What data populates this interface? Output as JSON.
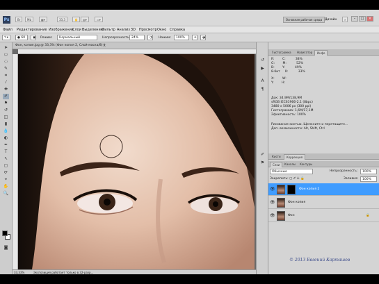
{
  "appbar": {
    "logo": "Ps",
    "zoom_display": "33,3",
    "workspace_label": "Основная рабочая среда",
    "workspace_active": "Дизайн",
    "min": "–",
    "max": "□",
    "close": "×"
  },
  "menu": [
    "Файл",
    "Редактирование",
    "Изображение",
    "Слои",
    "Выделение",
    "Фильтр",
    "Анализ",
    "3D",
    "Просмотр",
    "Окно",
    "Справка"
  ],
  "options": {
    "mode_label": "Режим:",
    "mode_value": "Нормальный",
    "opacity_label": "Непрозрачность:",
    "opacity_value": "24%",
    "flow_label": "Нажим:",
    "flow_value": "100%"
  },
  "document": {
    "tab_title": "Фон, копия.jpg @ 33,3% (Фон копия 2, Слой-маска/8) *",
    "close": "×",
    "status_zoom": "33,33%",
    "status_text": "Экспозиция работает только в 32-разр..."
  },
  "panels": {
    "top_tabs": [
      "Гистограмма",
      "Навигатор",
      "Инфо"
    ],
    "info_rows": [
      "R:        C:          38%",
      "G:        M:          52%",
      "B:        Y:          49%",
      "8-бит     K:          33%",
      "X:        W:",
      "Y:        H:",
      "Док: 34,9M/138,9M",
      "sRGB IEC61966-2.1 (8bpc)",
      "3480 x 5006 px (300 ppi)",
      "Гистограмма: 1,6M/17,1M",
      "Эфективность: 100%",
      "Рисование кистью. Щелкните и перетащите...",
      "Доп. возможности: Alt, Shift, Ctrl"
    ],
    "layer_tabs": [
      "Слои",
      "Каналы",
      "Контуры"
    ],
    "blend_mode": "Обычные",
    "opacity_label": "Непрозрачность:",
    "opacity_value": "100%",
    "lock_label": "Закрепить:",
    "fill_label": "Заливка:",
    "fill_value": "100%",
    "mini_tabs": [
      "Кисти",
      "Коррекция"
    ],
    "layers": [
      {
        "name": "Фон копия 2",
        "selected": true
      },
      {
        "name": "Фон копия",
        "selected": false
      },
      {
        "name": "Фон",
        "selected": false
      }
    ]
  },
  "watermark": "© 2013 Евгений Карташов",
  "colors": {
    "accent_selection": "#3f9cff",
    "panel_bg": "#d4d4d4"
  }
}
